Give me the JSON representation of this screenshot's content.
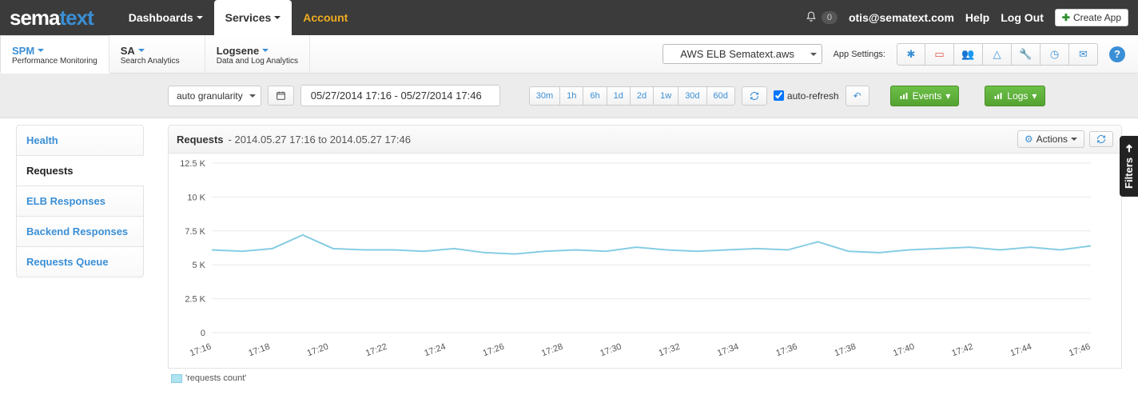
{
  "topnav": {
    "logo_sema": "sema",
    "logo_text": "text",
    "dashboards": "Dashboards",
    "services": "Services",
    "account": "Account",
    "notif_count": "0",
    "email": "otis@sematext.com",
    "help": "Help",
    "logout": "Log Out",
    "create_app": "Create App"
  },
  "subnav": {
    "svc": [
      {
        "title": "SPM",
        "sub": "Performance Monitoring"
      },
      {
        "title": "SA",
        "sub": "Search Analytics"
      },
      {
        "title": "Logsene",
        "sub": "Data and Log Analytics"
      }
    ],
    "app_dropdown": "AWS ELB Sematext.aws",
    "app_settings_label": "App Settings:"
  },
  "toolbar": {
    "granularity": "auto granularity",
    "date_range": "05/27/2014 17:16 - 05/27/2014 17:46",
    "ranges": [
      "30m",
      "1h",
      "6h",
      "1d",
      "2d",
      "1w",
      "30d",
      "60d"
    ],
    "auto_refresh": "auto-refresh",
    "events": "Events",
    "logs": "Logs"
  },
  "sidemenu": [
    "Health",
    "Requests",
    "ELB Responses",
    "Backend Responses",
    "Requests Queue"
  ],
  "chart": {
    "title": "Requests",
    "subtitle": " - 2014.05.27 17:16 to 2014.05.27 17:46",
    "actions": "Actions",
    "legend": "'requests count'"
  },
  "filters_label": "Filters",
  "chart_data": {
    "type": "line",
    "title": "Requests",
    "xlabel": "",
    "ylabel": "",
    "x_ticks": [
      "17:16",
      "17:18",
      "17:20",
      "17:22",
      "17:24",
      "17:26",
      "17:28",
      "17:30",
      "17:32",
      "17:34",
      "17:36",
      "17:38",
      "17:40",
      "17:42",
      "17:44",
      "17:46"
    ],
    "y_ticks_labels": [
      "0",
      "2.5 K",
      "5 K",
      "7.5 K",
      "10 K",
      "12.5 K"
    ],
    "y_ticks": [
      0,
      2500,
      5000,
      7500,
      10000,
      12500
    ],
    "ylim": [
      0,
      12500
    ],
    "series": [
      {
        "name": "requests count",
        "x": [
          "17:16",
          "17:17",
          "17:18",
          "17:19",
          "17:20",
          "17:21",
          "17:22",
          "17:23",
          "17:24",
          "17:25",
          "17:26",
          "17:27",
          "17:28",
          "17:29",
          "17:30",
          "17:31",
          "17:32",
          "17:33",
          "17:34",
          "17:35",
          "17:36",
          "17:37",
          "17:38",
          "17:39",
          "17:40",
          "17:41",
          "17:42",
          "17:43",
          "17:44",
          "17:45"
        ],
        "values": [
          6100,
          6000,
          6200,
          7200,
          6200,
          6100,
          6100,
          6000,
          6200,
          5900,
          5800,
          6000,
          6100,
          6000,
          6300,
          6100,
          6000,
          6100,
          6200,
          6100,
          6700,
          6000,
          5900,
          6100,
          6200,
          6300,
          6100,
          6300,
          6100,
          6400
        ]
      }
    ]
  }
}
